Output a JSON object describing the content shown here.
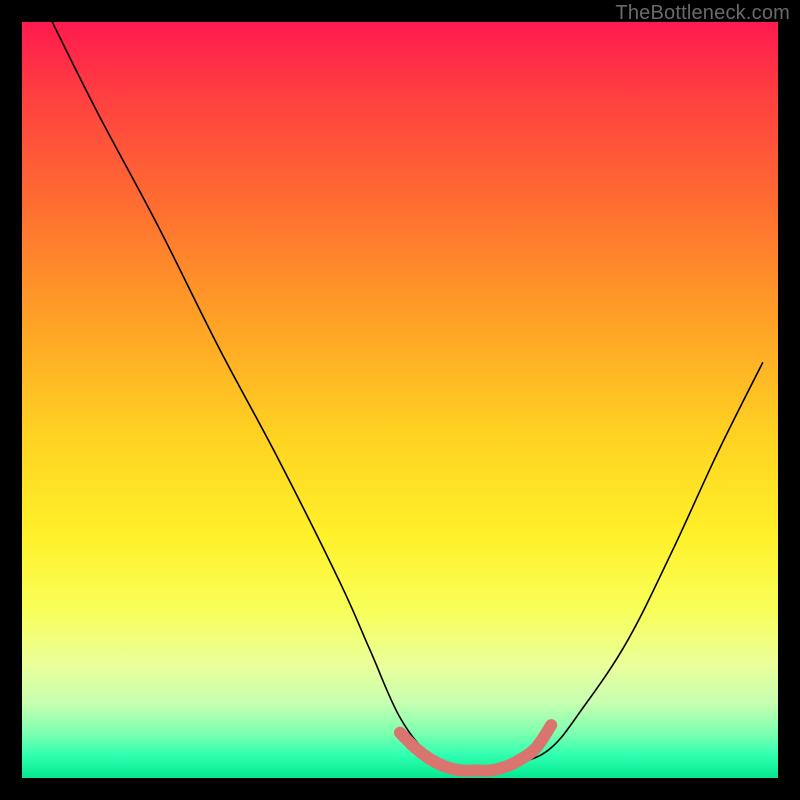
{
  "watermark": "TheBottleneck.com",
  "chart_data": {
    "type": "line",
    "title": "",
    "xlabel": "",
    "ylabel": "",
    "xlim": [
      0,
      100
    ],
    "ylim": [
      0,
      100
    ],
    "background": "red-yellow-green vertical gradient (red top, green bottom)",
    "series": [
      {
        "name": "bottleneck-curve",
        "x": [
          4,
          10,
          18,
          26,
          34,
          42,
          46,
          50,
          54,
          58,
          62,
          66,
          70,
          74,
          80,
          86,
          92,
          98
        ],
        "y": [
          100,
          88,
          73,
          57,
          42,
          26,
          17,
          8,
          3,
          1,
          1,
          2,
          4,
          9,
          18,
          30,
          43,
          55
        ],
        "color": "#000000",
        "stroke_width": 1.6
      },
      {
        "name": "optimal-band",
        "x": [
          50,
          52,
          54,
          56,
          58,
          60,
          62,
          64,
          66,
          68,
          70
        ],
        "y": [
          6,
          4,
          2.5,
          1.5,
          1,
          1,
          1,
          1.5,
          2.5,
          4,
          7
        ],
        "color": "#d9746f",
        "stroke_width": 12,
        "endpoints": "round"
      }
    ],
    "annotations": []
  }
}
